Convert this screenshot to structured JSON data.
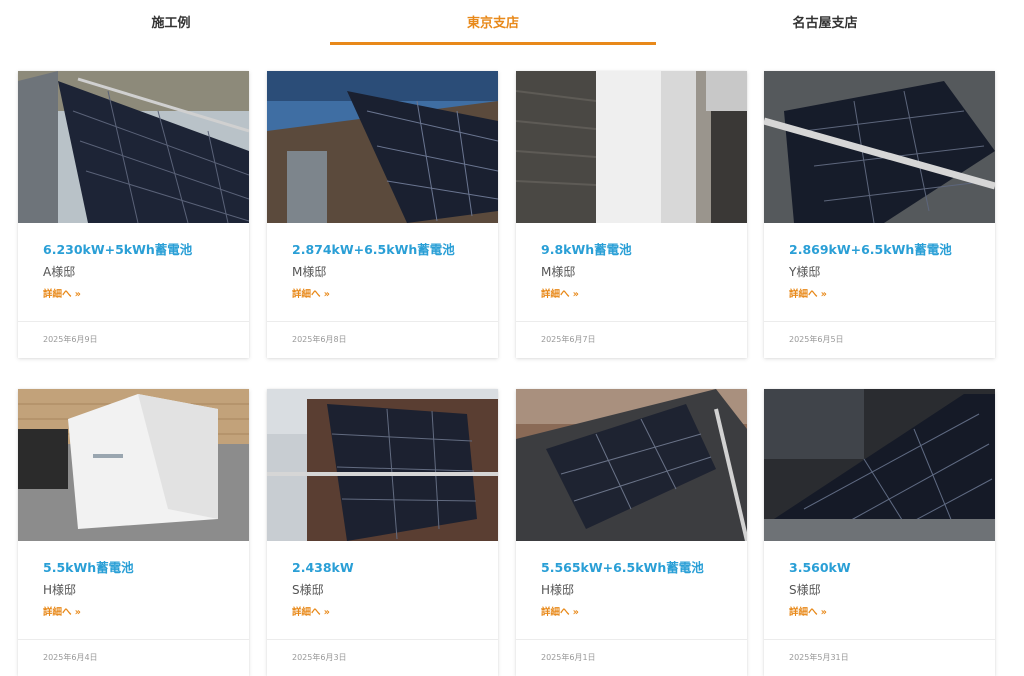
{
  "tabs": [
    {
      "label": "施工例",
      "active": false
    },
    {
      "label": "東京支店",
      "active": true
    },
    {
      "label": "名古屋支店",
      "active": false
    }
  ],
  "colors": {
    "accent": "#e8891a",
    "title": "#2a9fd6"
  },
  "cards": [
    {
      "title": "6.230kW+5kWh蓄電池",
      "owner": "A様邸",
      "more": "詳細へ »",
      "date": "2025年6月9日",
      "image": "solar-roof-photo"
    },
    {
      "title": "2.874kW+6.5kWh蓄電池",
      "owner": "M様邸",
      "more": "詳細へ »",
      "date": "2025年6月8日",
      "image": "solar-roof-photo"
    },
    {
      "title": "9.8kWh蓄電池",
      "owner": "M様邸",
      "more": "詳細へ »",
      "date": "2025年6月7日",
      "image": "battery-unit-photo"
    },
    {
      "title": "2.869kW+6.5kWh蓄電池",
      "owner": "Y様邸",
      "more": "詳細へ »",
      "date": "2025年6月5日",
      "image": "solar-roof-photo"
    },
    {
      "title": "5.5kWh蓄電池",
      "owner": "H様邸",
      "more": "詳細へ »",
      "date": "2025年6月4日",
      "image": "battery-unit-photo"
    },
    {
      "title": "2.438kW",
      "owner": "S様邸",
      "more": "詳細へ »",
      "date": "2025年6月3日",
      "image": "solar-roof-photo"
    },
    {
      "title": "5.565kW+6.5kWh蓄電池",
      "owner": "H様邸",
      "more": "詳細へ »",
      "date": "2025年6月1日",
      "image": "solar-roof-photo"
    },
    {
      "title": "3.560kW",
      "owner": "S様邸",
      "more": "詳細へ »",
      "date": "2025年5月31日",
      "image": "solar-roof-photo"
    }
  ]
}
